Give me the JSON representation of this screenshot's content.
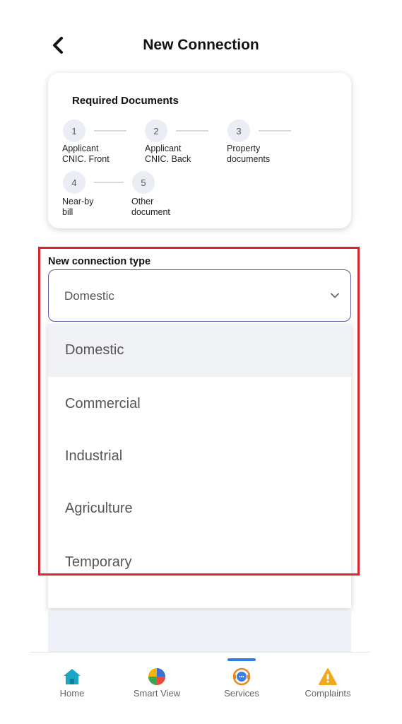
{
  "header": {
    "title": "New Connection",
    "back_icon": "chevron-left-icon"
  },
  "required_documents": {
    "title": "Required Documents",
    "steps": [
      {
        "number": "1",
        "label_line1": "Applicant",
        "label_line2": "CNIC. Front"
      },
      {
        "number": "2",
        "label_line1": "Applicant",
        "label_line2": "CNIC. Back"
      },
      {
        "number": "3",
        "label_line1": "Property",
        "label_line2": "documents"
      },
      {
        "number": "4",
        "label_line1": "Near-by",
        "label_line2": "bill"
      },
      {
        "number": "5",
        "label_line1": "Other",
        "label_line2": "document"
      }
    ]
  },
  "connection_type": {
    "label": "New connection type",
    "selected_value": "Domestic",
    "options": [
      "Domestic",
      "Commercial",
      "Industrial",
      "Agriculture",
      "Temporary"
    ]
  },
  "bottom_nav": {
    "items": [
      {
        "label": "Home",
        "icon": "home-icon"
      },
      {
        "label": "Smart View",
        "icon": "pie-chart-icon"
      },
      {
        "label": "Services",
        "icon": "support-agent-icon",
        "active": true
      },
      {
        "label": "Complaints",
        "icon": "warning-icon"
      }
    ]
  },
  "colors": {
    "accent_blue": "#2f7fe6",
    "select_border": "#5a5fa8",
    "highlight_red": "#d72631"
  }
}
